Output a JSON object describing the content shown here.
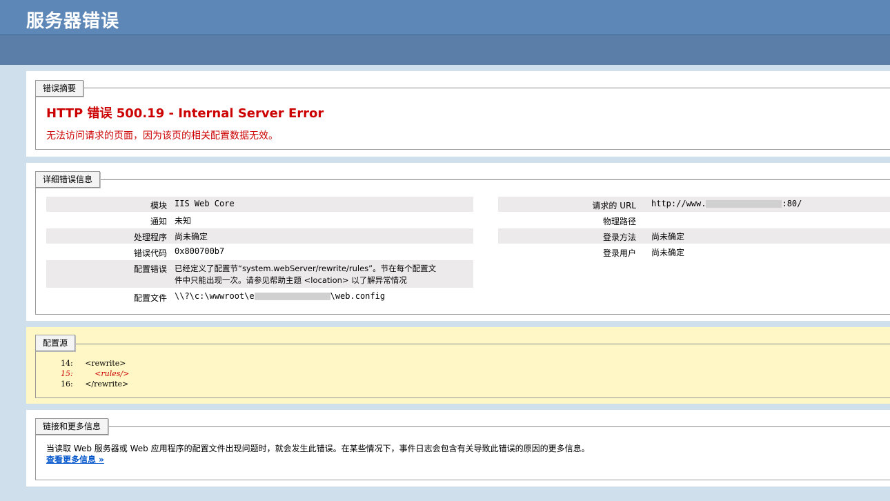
{
  "header": {
    "title": "服务器错误"
  },
  "summary": {
    "legend": "错误摘要",
    "error_title": "HTTP 错误 500.19 - Internal Server Error",
    "error_desc": "无法访问请求的页面，因为该页的相关配置数据无效。"
  },
  "detail": {
    "legend": "详细错误信息",
    "left_rows": [
      {
        "label": "模块",
        "value": "IIS Web Core"
      },
      {
        "label": "通知",
        "value": "未知"
      },
      {
        "label": "处理程序",
        "value": "尚未确定"
      },
      {
        "label": "错误代码",
        "value": "0x800700b7"
      },
      {
        "label": "配置错误",
        "value_line1": "已经定义了配置节“system.webServer/rewrite/rules”。节在每个配置文",
        "value_line2": "件中只能出现一次。请参见帮助主题 <location> 以了解异常情况"
      },
      {
        "label": "配置文件",
        "value_prefix": "\\\\?\\c:\\wwwroot\\e",
        "value_suffix": "\\web.config"
      }
    ],
    "right_rows": [
      {
        "label": "请求的 URL",
        "value_prefix": "http://www.",
        "value_suffix": ":80/"
      },
      {
        "label": "物理路径",
        "value": ""
      },
      {
        "label": "登录方法",
        "value": "尚未确定"
      },
      {
        "label": "登录用户",
        "value": "尚未确定"
      }
    ]
  },
  "config": {
    "legend": "配置源",
    "lines": [
      {
        "num": "14:",
        "code": "<rewrite>"
      },
      {
        "num": "15:",
        "code": "<rules/>"
      },
      {
        "num": "16:",
        "code": "</rewrite>"
      }
    ]
  },
  "links": {
    "legend": "链接和更多信息",
    "text": "当读取 Web 服务器或 Web 应用程序的配置文件出现问题时，就会发生此错误。在某些情况下，事件日志会包含有关导致此错误的原因的更多信息。",
    "more_link": "查看更多信息 »"
  }
}
